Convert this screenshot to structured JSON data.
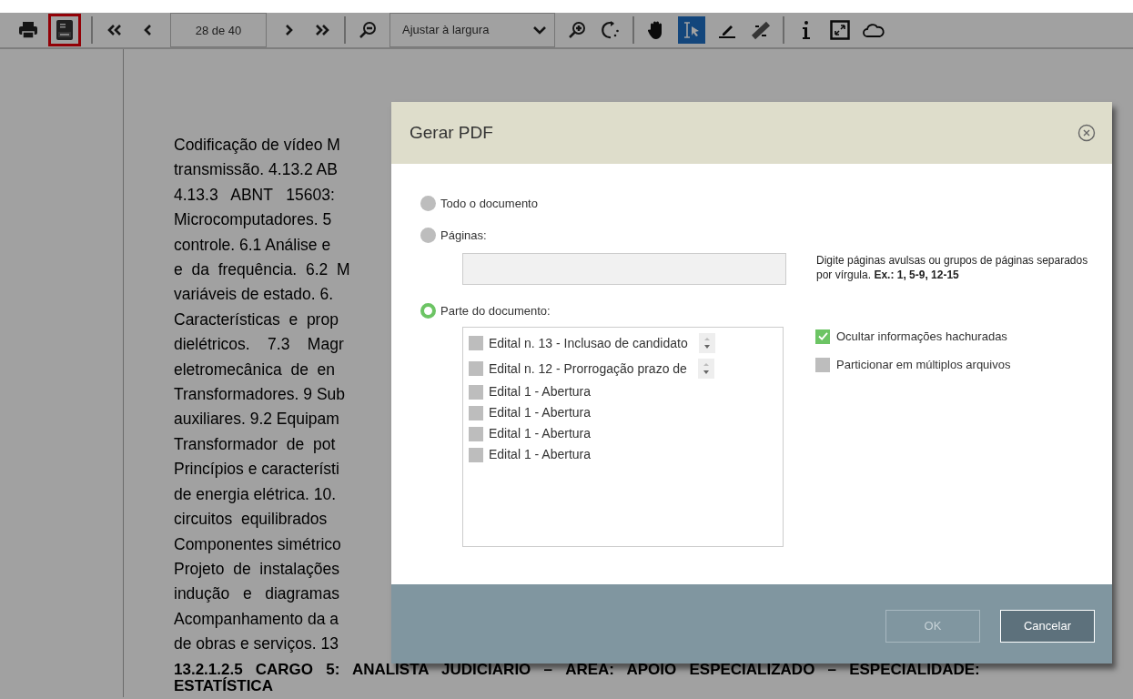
{
  "toolbar": {
    "print_highlighted": false,
    "pdf_highlighted": true,
    "page_field": "28 de 40",
    "zoom_select": "Ajustar à largura",
    "tools": [
      {
        "kind": "hand",
        "selected": false
      },
      {
        "kind": "text-select",
        "selected": true
      },
      {
        "kind": "highlight",
        "selected": false
      },
      {
        "kind": "redact",
        "selected": false
      }
    ]
  },
  "document": {
    "lines": [
      "Codificação de vídeo M",
      "transmissão. 4.13.2 AB",
      "4.13.3   ABNT   15603:",
      "Microcomputadores. 5",
      "controle. 6.1 Análise e",
      "e  da  frequência.  6.2  M",
      "variáveis de estado. 6.",
      "Características  e  prop",
      "dielétricos.    7.3    Magr",
      "eletromecânica  de  en",
      "Transformadores. 9 Sub",
      "auxiliares. 9.2 Equipam",
      "Transformador  de  pot",
      "Princípios e característi",
      "de energia elétrica. 10.",
      "circuitos  equilibrados",
      "Componentes simétrico",
      "Projeto  de  instalações",
      "indução   e   diagramas",
      "Acompanhamento da a",
      "de obras e serviços. 13"
    ],
    "heading_lines": [
      "13.2.1.2.5   CARGO   5:   ANALISTA   JUDICIÁRIO   –   ÁREA:   APOIO   ESPECIALIZADO   –   ESPECIALIDADE:",
      "ESTATÍSTICA"
    ]
  },
  "dialog": {
    "title": "Gerar PDF",
    "ranges": [
      {
        "label": "Todo o documento",
        "selected": false
      },
      {
        "label": "Páginas:",
        "selected": false
      },
      {
        "label": "Parte do documento:",
        "selected": true
      }
    ],
    "pages_hint": "Digite páginas avulsas ou grupos de páginas separados por vírgula. **Ex.: 1, 5-9, 12-15**",
    "parts": [
      {
        "label": "Edital n. 13 - Inclusao de candidato",
        "kind": "with-spinner",
        "checked": false
      },
      {
        "label": "Edital n. 12 - Prorrogação prazo de",
        "kind": "with-spinner",
        "checked": false
      },
      {
        "label": "Edital 1 - Abertura",
        "kind": "plain",
        "checked": false
      },
      {
        "label": "Edital 1 - Abertura",
        "kind": "plain",
        "checked": false
      },
      {
        "label": "Edital 1 - Abertura",
        "kind": "plain",
        "checked": false
      },
      {
        "label": "Edital 1 - Abertura",
        "kind": "plain",
        "checked": false
      }
    ],
    "options": [
      {
        "label": "Ocultar informações hachuradas",
        "checked": true
      },
      {
        "label": "Particionar em múltiplos arquivos",
        "checked": false
      }
    ],
    "buttons": [
      {
        "label": "OK",
        "disabled": true
      },
      {
        "label": "Cancelar",
        "disabled": false
      }
    ]
  }
}
